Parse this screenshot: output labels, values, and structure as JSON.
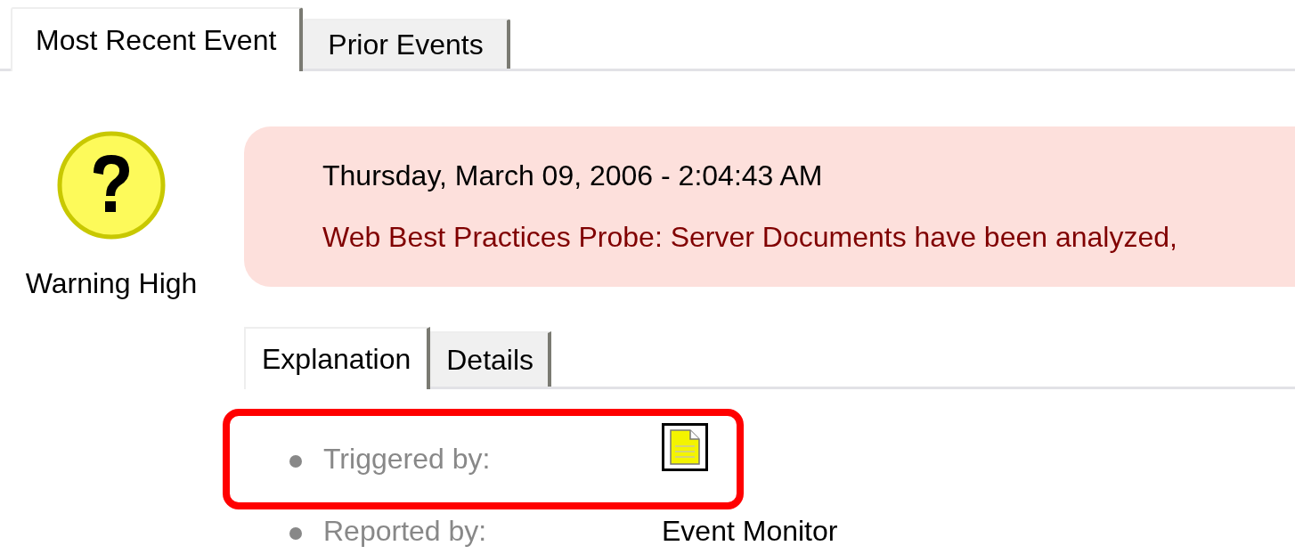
{
  "tabs": [
    {
      "label": "Most Recent Event",
      "selected": true
    },
    {
      "label": "Prior Events",
      "selected": false
    }
  ],
  "event": {
    "severity": {
      "kind": "warning",
      "label": "Warning High"
    },
    "timestamp": "Thursday, March 09, 2006 - 2:04:43 AM",
    "message": "Web Best Practices Probe: Server Documents have been analyzed,"
  },
  "detail_tabs": [
    {
      "label": "Explanation",
      "selected": true
    },
    {
      "label": "Details",
      "selected": false
    }
  ],
  "fields": [
    {
      "label": "Triggered by:",
      "kind": "icon",
      "highlighted": true
    },
    {
      "label": "Reported by:",
      "kind": "text",
      "value": "Event Monitor",
      "highlighted": false
    }
  ]
}
